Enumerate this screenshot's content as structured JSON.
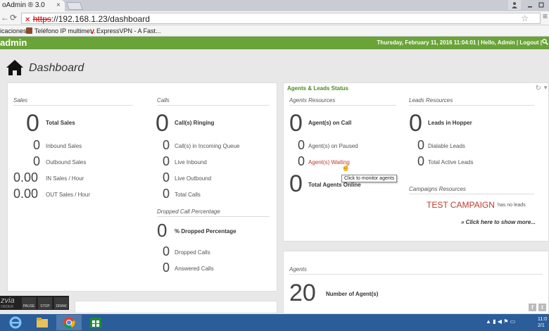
{
  "browser": {
    "tab_title": "oAdmin ® 3.0",
    "tab_close": "×",
    "url_scheme": "https",
    "url_rest": "://192.168.1.23/dashboard",
    "bookmarks": [
      {
        "label": "icaciones"
      },
      {
        "label": "Teléfono IP multime..."
      },
      {
        "label": "ExpressVPN - A Fast..."
      }
    ]
  },
  "header": {
    "brand": "admin",
    "datetime": "Thursday, February 11, 2016 11:04:01",
    "greeting": "Hello, Admin",
    "logout": "Logout",
    "separator": "|"
  },
  "page": {
    "title": "Dashboard"
  },
  "sales": {
    "title": "Sales",
    "total_value": "0",
    "total_label": "Total Sales",
    "inbound_value": "0",
    "inbound_label": "Inbound Sales",
    "outbound_value": "0",
    "outbound_label": "Outbound Sales",
    "in_hour_value": "0.00",
    "in_hour_label": "IN Sales / Hour",
    "out_hour_value": "0.00",
    "out_hour_label": "OUT Sales / Hour"
  },
  "calls": {
    "title": "Calls",
    "ringing_value": "0",
    "ringing_label": "Call(s) Ringing",
    "queue_value": "0",
    "queue_label": "Call(s) in Incoming Queue",
    "live_in_value": "0",
    "live_in_label": "Live Inbound",
    "live_out_value": "0",
    "live_out_label": "Live Outbound",
    "total_value": "0",
    "total_label": "Total Calls"
  },
  "dropped": {
    "title": "Dropped Call Percentage",
    "pct_value": "0",
    "pct_label": "% Dropped Percentage",
    "dropped_value": "0",
    "dropped_label": "Dropped Calls",
    "answered_value": "0",
    "answered_label": "Answered Calls"
  },
  "status": {
    "title": "Agents & Leads Status",
    "agents_resources": "Agents Resources",
    "on_call_value": "0",
    "on_call_label": "Agent(s) on Call",
    "paused_value": "0",
    "paused_label": "Agent(s) on Paused",
    "waiting_value": "0",
    "waiting_label": "Agent(s) Waiting",
    "online_value": "0",
    "online_label": "Total Agents Online",
    "tooltip": "Click to monitor agents",
    "leads_resources": "Leads Resources",
    "hopper_value": "0",
    "hopper_label": "Leads in Hopper",
    "dialable_value": "0",
    "dialable_label": "Dialable Leads",
    "active_value": "0",
    "active_label": "Total Active Leads",
    "campaigns_resources": "Campaigns Resources",
    "campaign_name": "TEST CAMPAIGN",
    "campaign_note": "has no leads",
    "show_more": "» Click here to show more..."
  },
  "agents": {
    "title": "Agents",
    "count_value": "20",
    "count_label": "Number of Agent(s)"
  },
  "recorder": {
    "logo": "zvia",
    "sub": "ORDER",
    "pause": "PAUSE",
    "stop": "STOP",
    "draw": "DRAW"
  },
  "taskbar": {
    "clock_time": "11:0",
    "clock_date": "2/1"
  },
  "colors": {
    "header_green": "#6aa337",
    "status_green": "#4a8a1f",
    "accent_red": "#c0392b",
    "taskbar_blue": "#2a5d9a"
  }
}
